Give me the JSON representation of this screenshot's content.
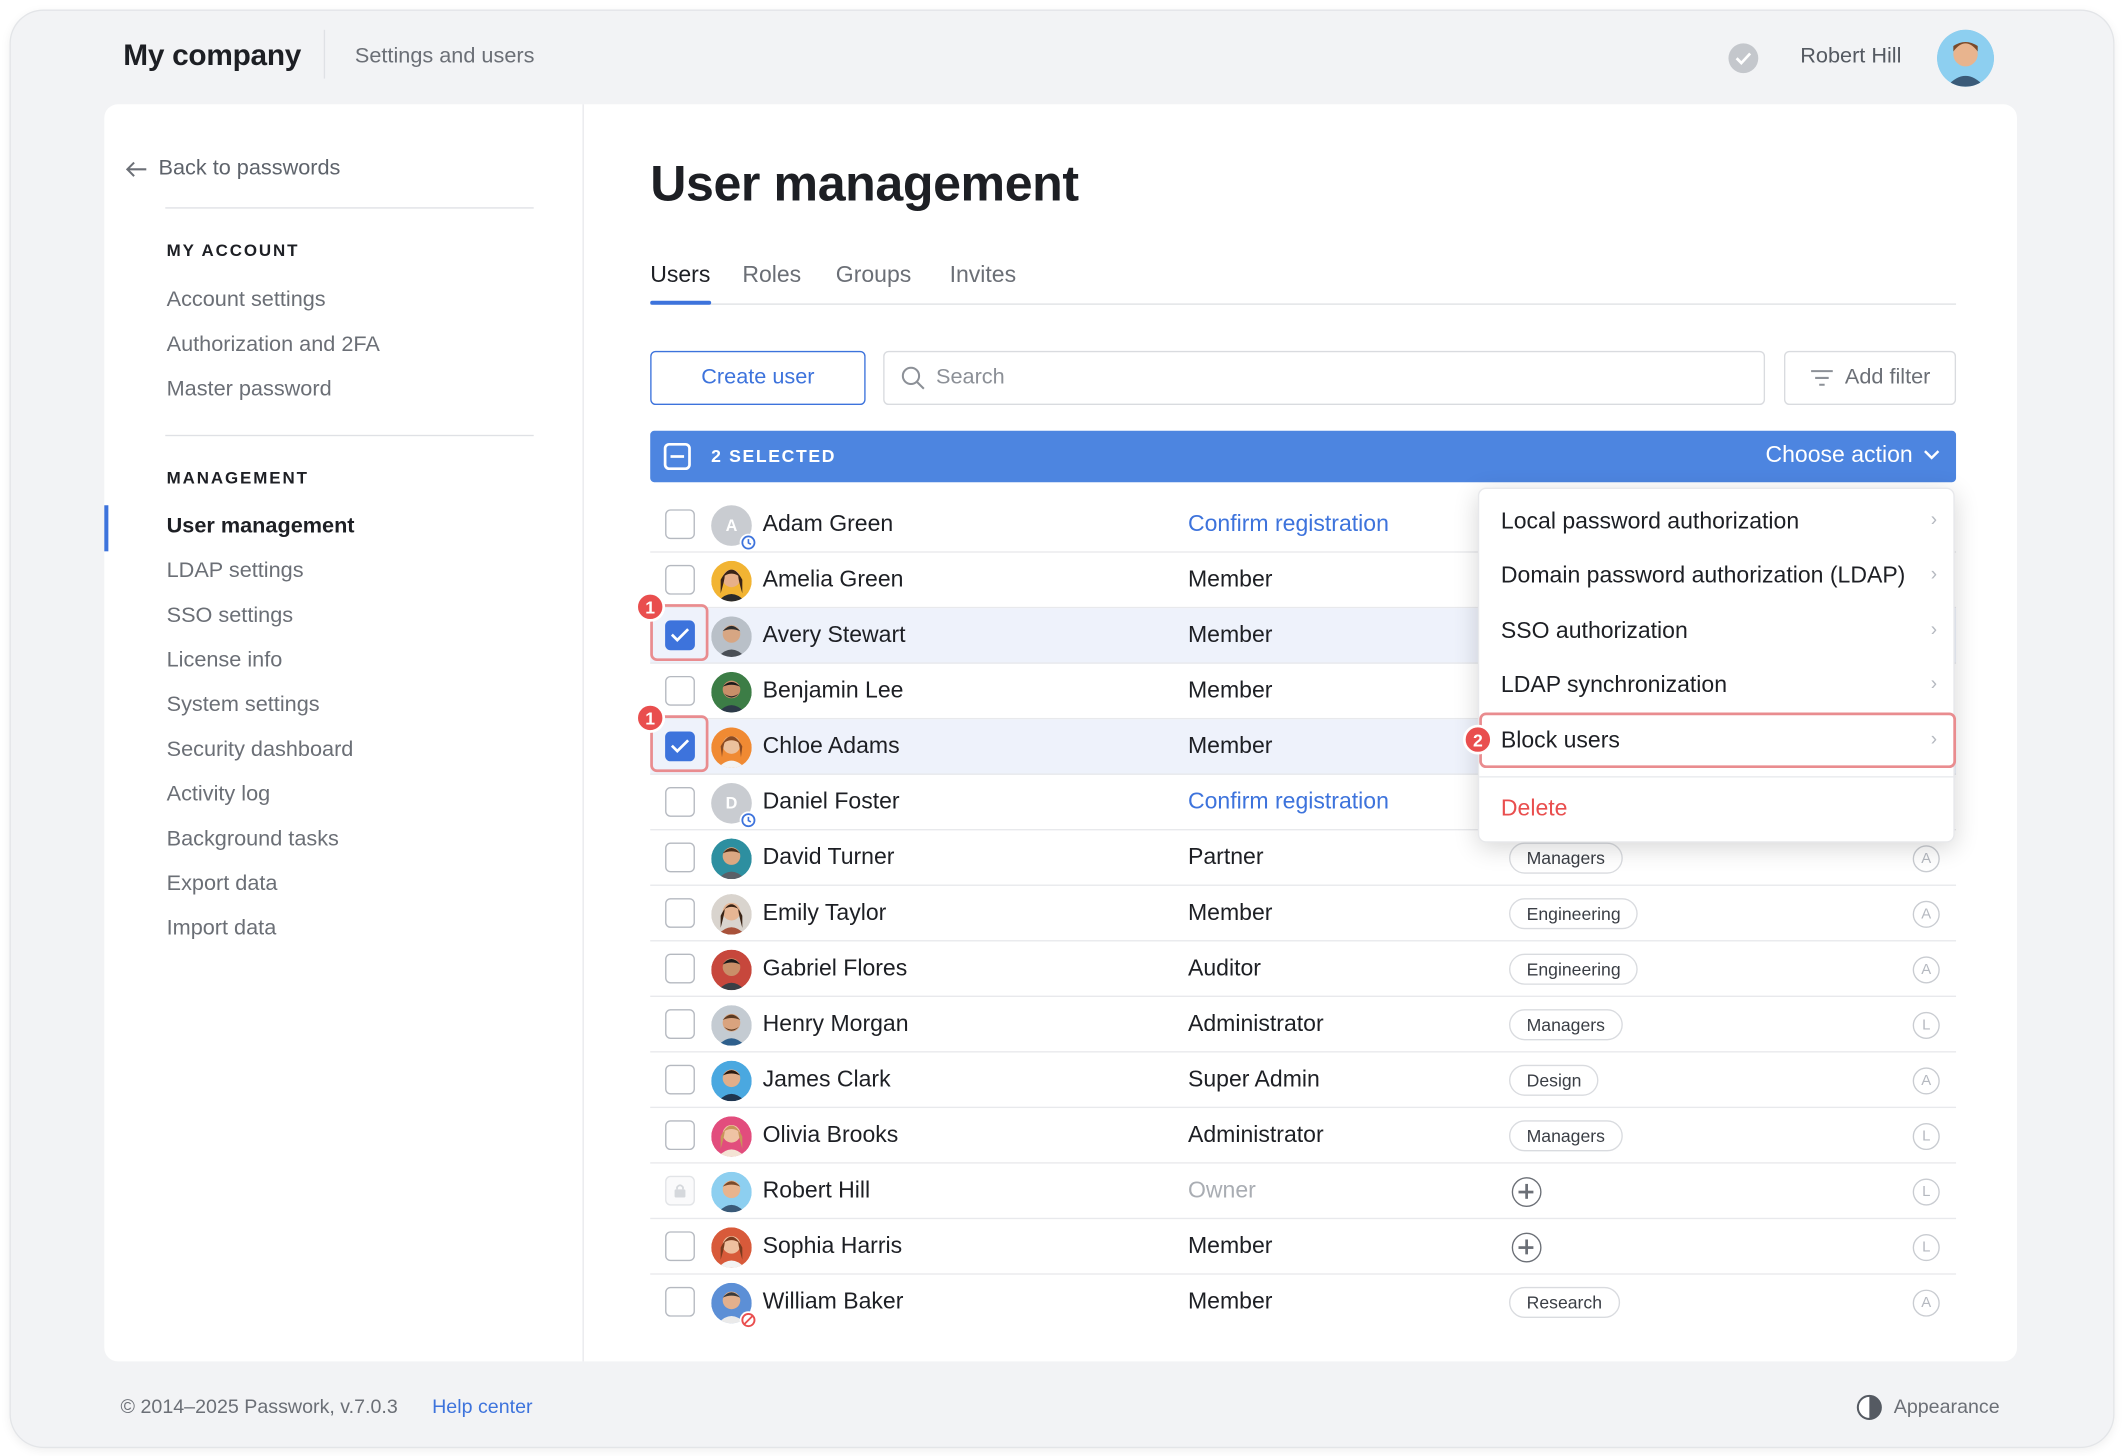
{
  "header": {
    "brand": "My company",
    "breadcrumb": "Settings and users",
    "user_name": "Robert Hill"
  },
  "sidebar": {
    "back_label": "Back to passwords",
    "my_account_title": "MY ACCOUNT",
    "my_account_items": [
      "Account settings",
      "Authorization and 2FA",
      "Master password"
    ],
    "management_title": "MANAGEMENT",
    "management_items": [
      "User management",
      "LDAP settings",
      "SSO settings",
      "License info",
      "System settings",
      "Security dashboard",
      "Activity log",
      "Background tasks",
      "Export data",
      "Import data"
    ]
  },
  "main": {
    "title": "User management",
    "tabs": [
      "Users",
      "Roles",
      "Groups",
      "Invites"
    ],
    "create_label": "Create user",
    "search_placeholder": "Search",
    "filter_label": "Add filter",
    "selected_label": "2 SELECTED",
    "choose_action_label": "Choose action"
  },
  "users": [
    {
      "name": "Adam Green",
      "role": "Confirm registration",
      "group": "",
      "auth": "",
      "initial": "A",
      "checked": false
    },
    {
      "name": "Amelia Green",
      "role": "Member",
      "group": "",
      "auth": "",
      "checked": false
    },
    {
      "name": "Avery Stewart",
      "role": "Member",
      "group": "",
      "auth": "",
      "checked": true
    },
    {
      "name": "Benjamin Lee",
      "role": "Member",
      "group": "",
      "auth": "",
      "checked": false
    },
    {
      "name": "Chloe Adams",
      "role": "Member",
      "group": "",
      "auth": "",
      "checked": true
    },
    {
      "name": "Daniel Foster",
      "role": "Confirm registration",
      "group": "",
      "auth": "",
      "initial": "D",
      "checked": false
    },
    {
      "name": "David Turner",
      "role": "Partner",
      "group": "Managers",
      "auth": "A",
      "checked": false
    },
    {
      "name": "Emily Taylor",
      "role": "Member",
      "group": "Engineering",
      "auth": "A",
      "checked": false
    },
    {
      "name": "Gabriel Flores",
      "role": "Auditor",
      "group": "Engineering",
      "auth": "A",
      "checked": false
    },
    {
      "name": "Henry Morgan",
      "role": "Administrator",
      "group": "Managers",
      "auth": "L",
      "checked": false
    },
    {
      "name": "James Clark",
      "role": "Super Admin",
      "group": "Design",
      "auth": "A",
      "checked": false
    },
    {
      "name": "Olivia Brooks",
      "role": "Administrator",
      "group": "Managers",
      "auth": "L",
      "checked": false
    },
    {
      "name": "Robert Hill",
      "role": "Owner",
      "group": "",
      "auth": "L",
      "checked": false
    },
    {
      "name": "Sophia Harris",
      "role": "Member",
      "group": "",
      "auth": "L",
      "checked": false
    },
    {
      "name": "William Baker",
      "role": "Member",
      "group": "Research",
      "auth": "A",
      "checked": false
    }
  ],
  "action_menu": {
    "items": [
      "Local password authorization",
      "Domain password authorization (LDAP)",
      "SSO authorization",
      "LDAP synchronization",
      "Block users"
    ],
    "delete_label": "Delete"
  },
  "annotations": {
    "step1": "1",
    "step2": "2"
  },
  "footer": {
    "copyright": "© 2014–2025 Passwork, v.7.0.3",
    "help": "Help center",
    "appearance": "Appearance"
  },
  "colors": {
    "accent": "#3d73dc",
    "selection_bar": "#4d85e0",
    "danger": "#e94e4e",
    "highlight": "#e98c8f"
  }
}
